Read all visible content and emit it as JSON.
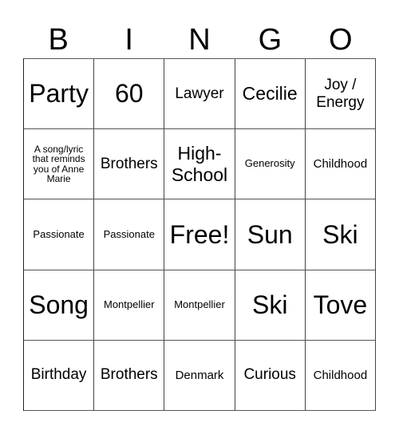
{
  "header": [
    "B",
    "I",
    "N",
    "G",
    "O"
  ],
  "cells": [
    [
      "Party",
      "60",
      "Lawyer",
      "Cecilie",
      "Joy / Energy"
    ],
    [
      "A song/lyric that reminds you of Anne Marie",
      "Brothers",
      "High-School",
      "Generosity",
      "Childhood"
    ],
    [
      "Passionate",
      "Passionate",
      "Free!",
      "Sun",
      "Ski"
    ],
    [
      "Song",
      "Montpellier",
      "Montpellier",
      "Ski",
      "Tove"
    ],
    [
      "Birthday",
      "Brothers",
      "Denmark",
      "Curious",
      "Childhood"
    ]
  ]
}
